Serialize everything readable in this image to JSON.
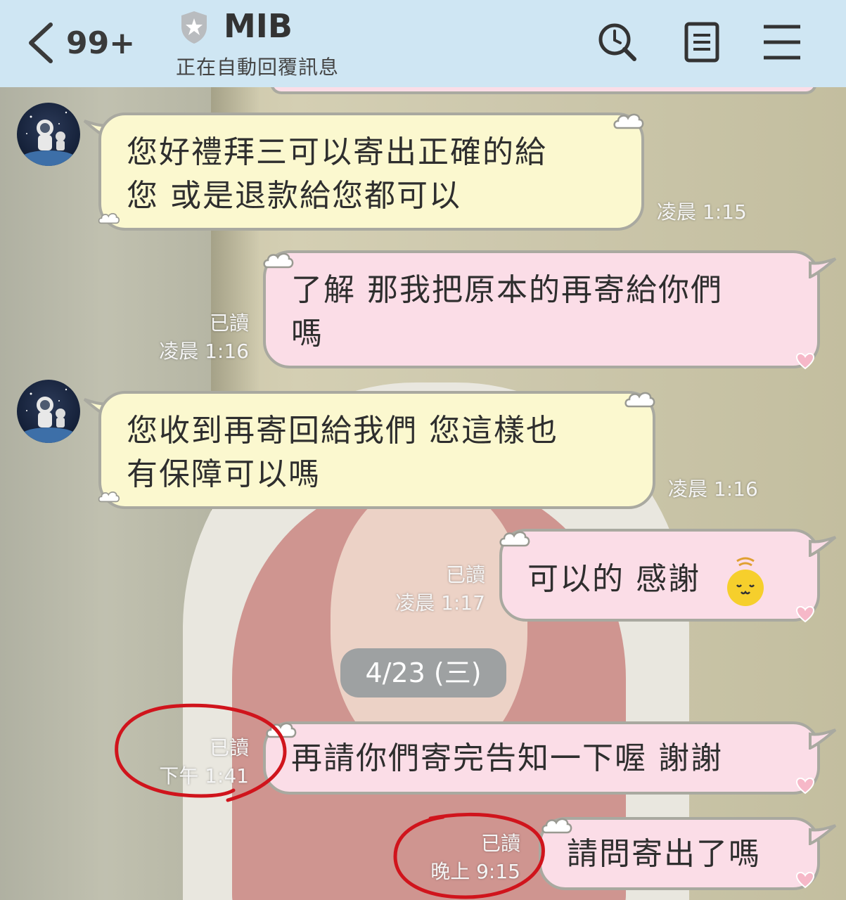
{
  "header": {
    "back_count": "99+",
    "title": "MIB",
    "subtitle": "正在自動回覆訊息",
    "bg_color": "#cfe6f3",
    "icons": [
      "back-chevron-icon",
      "shield-icon",
      "search-clock-icon",
      "notes-icon",
      "menu-icon"
    ]
  },
  "messages": [
    {
      "side": "in",
      "text": "您好禮拜三可以寄出正確的給您 或是退款給您都可以",
      "line1": "您好禮拜三可以寄出正確的給",
      "line2": "您 或是退款給您都可以",
      "time": "凌晨 1:15"
    },
    {
      "side": "out",
      "text": "了解 那我把原本的再寄給你們嗎",
      "line1": "了解 那我把原本的再寄給你們",
      "line2": "嗎",
      "read": "已讀",
      "time": "凌晨 1:16"
    },
    {
      "side": "in",
      "text": "您收到再寄回給我們 您這樣也有保障可以嗎",
      "line1": "您收到再寄回給我們 您這樣也",
      "line2": "有保障可以嗎",
      "time": "凌晨 1:16"
    },
    {
      "side": "out",
      "text": "可以的 感謝",
      "read": "已讀",
      "time": "凌晨 1:17"
    },
    {
      "side": "out",
      "text": "再請你們寄完告知一下喔 謝謝",
      "read": "已讀",
      "time": "下午 1:41"
    },
    {
      "side": "out",
      "text": "請問寄出了嗎",
      "read": "已讀",
      "time": "晚上 9:15"
    }
  ],
  "date_divider": "4/23 (三)",
  "colors": {
    "incoming_bubble": "#fbf8cf",
    "outgoing_bubble": "#fbdde7",
    "annotation_ring": "#d0141c"
  }
}
